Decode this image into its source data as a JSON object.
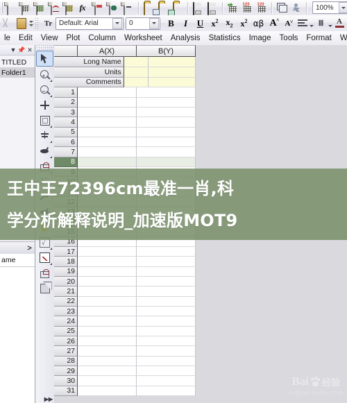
{
  "app": {
    "name": "OriginLab Origin",
    "zoom_level": "100%"
  },
  "toolbar_top": {
    "buttons": [
      {
        "name": "new-project",
        "icon": "new-project-icon",
        "label": "New Project"
      },
      {
        "name": "new-workbook",
        "icon": "new-workbook-icon",
        "label": "New Workbook"
      },
      {
        "name": "new-excel",
        "icon": "new-excel-icon",
        "label": "New Excel"
      },
      {
        "name": "new-graph",
        "icon": "new-graph-icon",
        "label": "New Graph"
      },
      {
        "name": "new-matrix",
        "icon": "new-matrix-icon",
        "label": "New Matrix"
      },
      {
        "name": "new-function-plot",
        "icon": "fx-icon",
        "label": "New Function Plot"
      },
      {
        "name": "new-layout",
        "icon": "new-layout-icon",
        "label": "New Layout"
      },
      {
        "name": "new-notes",
        "icon": "new-notes-icon",
        "label": "New Notes"
      },
      {
        "name": "new-from-template",
        "icon": "template-icon",
        "label": "New Workbook From Template"
      },
      {
        "name": "open-project",
        "icon": "open-folder-icon",
        "label": "Open"
      },
      {
        "name": "open-excel",
        "icon": "open-excel-icon",
        "label": "Open Excel"
      },
      {
        "name": "import-wizard",
        "icon": "import-wizard-icon",
        "label": "Open Template"
      },
      {
        "name": "save-project",
        "icon": "save-icon",
        "label": "Save Project"
      },
      {
        "name": "save-template",
        "icon": "save-template-icon",
        "label": "Save Template As"
      },
      {
        "name": "import-single-ascii",
        "icon": "import-ascii-icon",
        "label": "Import Single ASCII"
      },
      {
        "name": "import-multiple-ascii",
        "icon": "import-multi-ascii-icon",
        "label": "Import Multiple ASCII"
      },
      {
        "name": "import-wizard-2",
        "icon": "import-wizard2-icon",
        "label": "Import Wizard"
      },
      {
        "name": "duplicate-sheet",
        "icon": "duplicate-icon",
        "label": "Duplicate"
      },
      {
        "name": "run-script",
        "icon": "runner-icon",
        "label": "Run Script"
      }
    ],
    "zoom_value": "100%",
    "print_button": "print-icon",
    "print_preview_button": "print-preview-icon"
  },
  "toolbar_format": {
    "font_family": "Default: Arial",
    "font_size": "0",
    "buttons": [
      {
        "name": "bold",
        "label": "B"
      },
      {
        "name": "italic",
        "label": "I"
      },
      {
        "name": "underline",
        "label": "U"
      },
      {
        "name": "superscript",
        "label": "x2"
      },
      {
        "name": "subscript",
        "label": "x2"
      },
      {
        "name": "superscript-subscript",
        "label": "x2"
      },
      {
        "name": "greek",
        "label": "αβ"
      },
      {
        "name": "increase-font",
        "label": "A"
      },
      {
        "name": "decrease-font",
        "label": "A"
      },
      {
        "name": "align",
        "label": "align"
      },
      {
        "name": "rotate-text",
        "label": "rotate"
      },
      {
        "name": "font-color",
        "label": "A"
      }
    ]
  },
  "menubar": {
    "items": [
      "le",
      "Edit",
      "View",
      "Plot",
      "Column",
      "Worksheet",
      "Analysis",
      "Statistics",
      "Image",
      "Tools",
      "Format",
      "Windo"
    ]
  },
  "explorer": {
    "title_icons": [
      "chevron-down-icon",
      "pin-icon",
      "close-icon"
    ],
    "tree": [
      {
        "label": "TITLED",
        "selected": false
      },
      {
        "label": "Folder1",
        "selected": true
      }
    ],
    "nav_next": ">",
    "column_header": "ame"
  },
  "tools": {
    "items": [
      {
        "name": "pointer-tool",
        "icon": "arrow-icon",
        "selected": true
      },
      {
        "name": "zoom-in-tool",
        "icon": "magnifier-plus-icon",
        "selected": false
      },
      {
        "name": "zoom-out-tool",
        "icon": "magnifier-minus-icon",
        "selected": false
      },
      {
        "name": "screen-reader-tool",
        "icon": "crosshair-icon",
        "selected": false
      },
      {
        "name": "data-reader-tool",
        "icon": "frame-icon",
        "selected": false
      },
      {
        "name": "data-selector-tool",
        "icon": "spark-icon",
        "selected": false
      },
      {
        "name": "draw-data-tool",
        "icon": "dots-icon",
        "selected": false
      },
      {
        "name": "regional-mask-tool",
        "icon": "ellipse-icon",
        "selected": false
      },
      {
        "name": "arrow-annotation-tool",
        "icon": "arrow-line-icon",
        "selected": false
      },
      {
        "name": "pan-tool",
        "icon": "hand-icon",
        "selected": false
      },
      {
        "name": "region-stats-tool",
        "icon": "region-box-icon",
        "selected": false
      },
      {
        "name": "plot-region-tool",
        "icon": "plot-box-icon",
        "selected": false
      },
      {
        "name": "mask-tool",
        "icon": "mask-icon",
        "selected": false
      },
      {
        "name": "object-tool",
        "icon": "cube-icon",
        "selected": false
      }
    ]
  },
  "worksheet": {
    "columns": [
      "A(X)",
      "B(Y)"
    ],
    "meta_rows": [
      "Long Name",
      "Units",
      "Comments"
    ],
    "data_rows": [
      {
        "n": "1",
        "selected": false
      },
      {
        "n": "2",
        "selected": false
      },
      {
        "n": "3",
        "selected": false
      },
      {
        "n": "4",
        "selected": false
      },
      {
        "n": "5",
        "selected": false
      },
      {
        "n": "6",
        "selected": false
      },
      {
        "n": "7",
        "selected": false
      },
      {
        "n": "8",
        "selected": true
      },
      {
        "n": "9",
        "selected": false
      },
      {
        "n": "10",
        "selected": false
      },
      {
        "n": "11",
        "selected": false
      },
      {
        "n": "12",
        "selected": false
      },
      {
        "n": "13",
        "selected": false
      },
      {
        "n": "14",
        "selected": false
      },
      {
        "n": "15",
        "selected": false
      },
      {
        "n": "16",
        "selected": false
      },
      {
        "n": "17",
        "selected": false
      },
      {
        "n": "18",
        "selected": false
      },
      {
        "n": "19",
        "selected": false
      },
      {
        "n": "20",
        "selected": false
      },
      {
        "n": "21",
        "selected": false
      },
      {
        "n": "22",
        "selected": false
      },
      {
        "n": "23",
        "selected": false
      },
      {
        "n": "24",
        "selected": false
      },
      {
        "n": "25",
        "selected": false
      },
      {
        "n": "26",
        "selected": false
      },
      {
        "n": "27",
        "selected": false
      },
      {
        "n": "28",
        "selected": false
      },
      {
        "n": "29",
        "selected": false
      },
      {
        "n": "30",
        "selected": false
      },
      {
        "n": "31",
        "selected": false
      }
    ]
  },
  "overlay": {
    "line1": "王中王72396cm最准一肖,科",
    "line2": "学分析解释说明_加速版MOT9",
    "band_color": "#7a8f6b"
  },
  "watermark": {
    "brand": "Bai",
    "suffix": "经验",
    "url": "jingyan.baidu.com"
  }
}
